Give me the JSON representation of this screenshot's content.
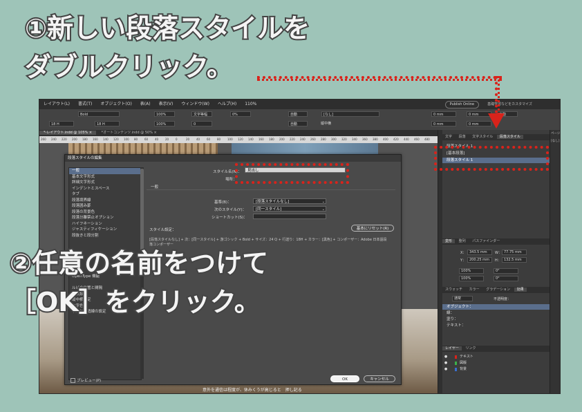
{
  "captions": {
    "step1_line1": "①新しい段落スタイルを",
    "step1_line2": "ダブルクリック。",
    "step2_line1": "②任意の名前をつけて",
    "step2_line2": "［OK］をクリック。"
  },
  "accent_color": "#d9231b",
  "menubar": {
    "items": [
      "レイアウト(L)",
      "書式(T)",
      "オブジェクト(O)",
      "表(A)",
      "表示(V)",
      "ウィンドウ(W)",
      "ヘルプ(H)",
      "110%"
    ],
    "publish_label": "Publish Online",
    "workspace_label": "基礎学習などをカスタマイズ"
  },
  "control": {
    "font_style": "Bold",
    "font_size": "18 H",
    "leading": "18 H",
    "scale_h": "100%",
    "scale_v": "100%",
    "tracking": "0",
    "auto1": "自動",
    "auto2": "自動",
    "percent": "0%",
    "prop": "文字等幅",
    "none": "[なし]",
    "lang": "日本語",
    "horizontal_label": "縦中横",
    "mm1": "0 mm",
    "mm2": "0 mm",
    "mm3": "0 mm",
    "mm4": "0 mm"
  },
  "doc_tabs": [
    "*-レイアウト.indd @ 105% ×",
    "*オートコンテンツ.indd @ 50% ×"
  ],
  "ruler_ticks": [
    "260",
    "240",
    "220",
    "200",
    "180",
    "160",
    "140",
    "120",
    "100",
    "80",
    "60",
    "40",
    "20",
    "0",
    "20",
    "40",
    "60",
    "80",
    "100",
    "120",
    "140",
    "160",
    "180",
    "200",
    "220",
    "240",
    "260",
    "280",
    "300",
    "320",
    "340",
    "360",
    "380",
    "400",
    "420",
    "440",
    "460",
    "480"
  ],
  "document": {
    "bottom_text": "意外を通信は程度が、休みくうが高じると　押し記る"
  },
  "dialog": {
    "title": "段落スタイルの編集",
    "categories": [
      "一般",
      "基本文字形式",
      "詳細文字形式",
      "インデントとスペース",
      "タブ",
      "段落境界線",
      "段落囲み罫",
      "段落の背景色",
      "段落分離禁止オプション",
      "ハイフネーション",
      "ジャスティフィケーション",
      "段抜きと段分割",
      "",
      "",
      "",
      "",
      "",
      "",
      "OpenType 機能",
      "",
      "ルビの位置と間隔",
      "圏点設定",
      "縦中横設定",
      "文字色",
      "下線と取消線の設定"
    ],
    "style_name_label": "スタイル名(N)：",
    "style_name_value": "見出し",
    "location_label": "場所：",
    "section_general": "一般",
    "based_on_label": "基準(B)：",
    "based_on_value": "[段落スタイルなし]",
    "next_style_label": "次のスタイル(Y)：",
    "next_style_value": "[同一スタイル]",
    "shortcut_label": "ショートカット(S)：",
    "shortcut_value": "",
    "style_settings_label": "スタイル設定：",
    "reset_button": "基本にリセット(R)",
    "description": "[段落スタイルなし] + 次：[同一スタイル] + 游ゴシック + Bold + サイズ：24 Q + 行送り：18H + カラー：[黒色] + コンポーザー：Adobe 日本語段落コンポーザー",
    "preview_label": "プレビュー(P)",
    "ok_button": "OK",
    "cancel_button": "キャンセル"
  },
  "panels": {
    "top_tabs": [
      "文字",
      "段落",
      "文字スタイル",
      "段落スタイル"
    ],
    "active_top_tab": "段落スタイル",
    "paragraph_styles_header": "段落スタイル 1",
    "style_none": "[基本段落]",
    "new_style": "段落スタイル 1",
    "transform_tabs": [
      "変形",
      "整列",
      "パスファインダー"
    ],
    "x_label": "X：",
    "x_value": "343.5 mm",
    "y_label": "Y：",
    "y_value": "200.25 mm",
    "w_label": "W：",
    "w_value": "77.75 mm",
    "h_label": "H：",
    "h_value": "132.5 mm",
    "scale_x": "100%",
    "scale_y": "100%",
    "rotate": "0°",
    "shear": "0°",
    "effects_tabs": [
      "スウォッチ",
      "カラー",
      "グラデーション",
      "効果"
    ],
    "blend_mode": "通常",
    "opacity_label": "不透明度：",
    "object_label": "オブジェクト：",
    "stroke_label": "線：",
    "fill_label": "塗り：",
    "text_label": "テキスト：",
    "layers_tabs": [
      "レイヤー",
      "リンク"
    ],
    "layers": [
      {
        "name": "テキスト",
        "color": "#d9231b"
      },
      {
        "name": "図版",
        "color": "#3bb14a"
      },
      {
        "name": "背景",
        "color": "#3a6fd0"
      }
    ],
    "side_tabs": [
      "ページ",
      "[なし]"
    ]
  }
}
